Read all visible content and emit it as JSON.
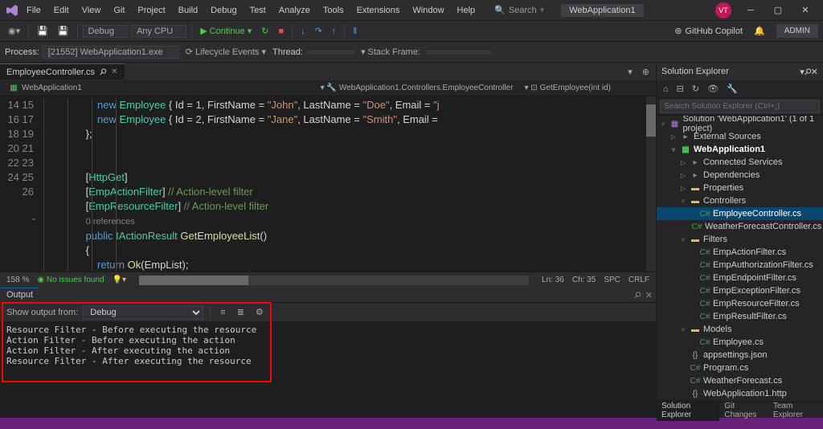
{
  "menu": {
    "items": [
      "File",
      "Edit",
      "View",
      "Git",
      "Project",
      "Build",
      "Debug",
      "Test",
      "Analyze",
      "Tools",
      "Extensions",
      "Window",
      "Help"
    ],
    "search_label": "Search",
    "title": "WebApplication1",
    "user_initials": "VT",
    "copilot": "GitHub Copilot",
    "admin": "ADMIN"
  },
  "toolbar1": {
    "config": "Debug",
    "platform": "Any CPU",
    "continue": "Continue"
  },
  "toolbar2": {
    "process_label": "Process:",
    "process": "[21552] WebApplication1.exe",
    "lifecycle": "Lifecycle Events",
    "thread": "Thread:",
    "stack": "Stack Frame:"
  },
  "tabs": {
    "active": "EmployeeController.cs"
  },
  "breadcrumb": {
    "a": "WebApplication1",
    "b": "WebApplication1.Controllers.EmployeeController",
    "c": "GetEmployee(int id)"
  },
  "code": {
    "lines": [
      14,
      15,
      16,
      17,
      18,
      19,
      20,
      21,
      "",
      22,
      23,
      24,
      25,
      26
    ],
    "l14": "        new Employee { Id = 1, FirstName = \"John\", LastName = \"Doe\", Email = \"j",
    "l15": "        new Employee { Id = 2, FirstName = \"Jane\", LastName = \"Smith\", Email = ",
    "l16": "    };",
    "l19a": "[",
    "l19b": "HttpGet",
    "l19c": "]",
    "l20a": "[",
    "l20b": "EmpActionFilter",
    "l20c": "] ",
    "l20d": "// Action-level filter",
    "l21a": "[",
    "l21b": "EmpResourceFilter",
    "l21c": "] ",
    "l21d": "// Action-level filter",
    "refs": "0 references",
    "l22a": "public ",
    "l22b": "IActionResult ",
    "l22c": "GetEmployeeList",
    "l22d": "()",
    "l23": "{",
    "l24a": "    return ",
    "l24b": "Ok",
    "l24c": "(EmpList);",
    "l25": "}"
  },
  "editor_status": {
    "zoom": "158 %",
    "issues": "No issues found",
    "ln": "Ln: 36",
    "ch": "Ch: 35",
    "spc": "SPC",
    "crlf": "CRLF"
  },
  "output": {
    "panel": "Output",
    "show_from": "Show output from:",
    "source": "Debug",
    "lines": [
      "Resource Filter - Before executing the resource",
      "Action Filter - Before executing the action",
      "Action Filter - After executing the action",
      "Resource Filter - After executing the resource"
    ]
  },
  "solution": {
    "title": "Solution Explorer",
    "search_placeholder": "Search Solution Explorer (Ctrl+;)",
    "root": "Solution 'WebApplication1' (1 of 1 project)",
    "items": [
      {
        "d": 1,
        "t": "▷",
        "i": "ref",
        "l": "External Sources"
      },
      {
        "d": 1,
        "t": "▿",
        "i": "proj",
        "l": "WebApplication1",
        "bold": true
      },
      {
        "d": 2,
        "t": "▷",
        "i": "ref",
        "l": "Connected Services"
      },
      {
        "d": 2,
        "t": "▷",
        "i": "ref",
        "l": "Dependencies"
      },
      {
        "d": 2,
        "t": "▷",
        "i": "fold",
        "l": "Properties"
      },
      {
        "d": 2,
        "t": "▿",
        "i": "fold",
        "l": "Controllers"
      },
      {
        "d": 3,
        "t": "",
        "i": "cs",
        "l": "EmployeeController.cs",
        "sel": true
      },
      {
        "d": 3,
        "t": "",
        "i": "cs",
        "l": "WeatherForecastController.cs"
      },
      {
        "d": 2,
        "t": "▿",
        "i": "fold",
        "l": "Filters"
      },
      {
        "d": 3,
        "t": "",
        "i": "cs",
        "l": "EmpActionFilter.cs"
      },
      {
        "d": 3,
        "t": "",
        "i": "cs",
        "l": "EmpAuthorizationFilter.cs"
      },
      {
        "d": 3,
        "t": "",
        "i": "cs",
        "l": "EmpEndpointFilter.cs"
      },
      {
        "d": 3,
        "t": "",
        "i": "cs",
        "l": "EmpExceptionFilter.cs"
      },
      {
        "d": 3,
        "t": "",
        "i": "cs",
        "l": "EmpResourceFilter.cs"
      },
      {
        "d": 3,
        "t": "",
        "i": "cs",
        "l": "EmpResultFilter.cs"
      },
      {
        "d": 2,
        "t": "▿",
        "i": "fold",
        "l": "Models"
      },
      {
        "d": 3,
        "t": "",
        "i": "cs",
        "l": "Employee.cs"
      },
      {
        "d": 2,
        "t": "",
        "i": "json",
        "l": "appsettings.json"
      },
      {
        "d": 2,
        "t": "",
        "i": "cs",
        "l": "Program.cs"
      },
      {
        "d": 2,
        "t": "",
        "i": "cs",
        "l": "WeatherForecast.cs"
      },
      {
        "d": 2,
        "t": "",
        "i": "json",
        "l": "WebApplication1.http"
      }
    ],
    "tabs": [
      "Solution Explorer",
      "Git Changes",
      "Team Explorer"
    ]
  }
}
